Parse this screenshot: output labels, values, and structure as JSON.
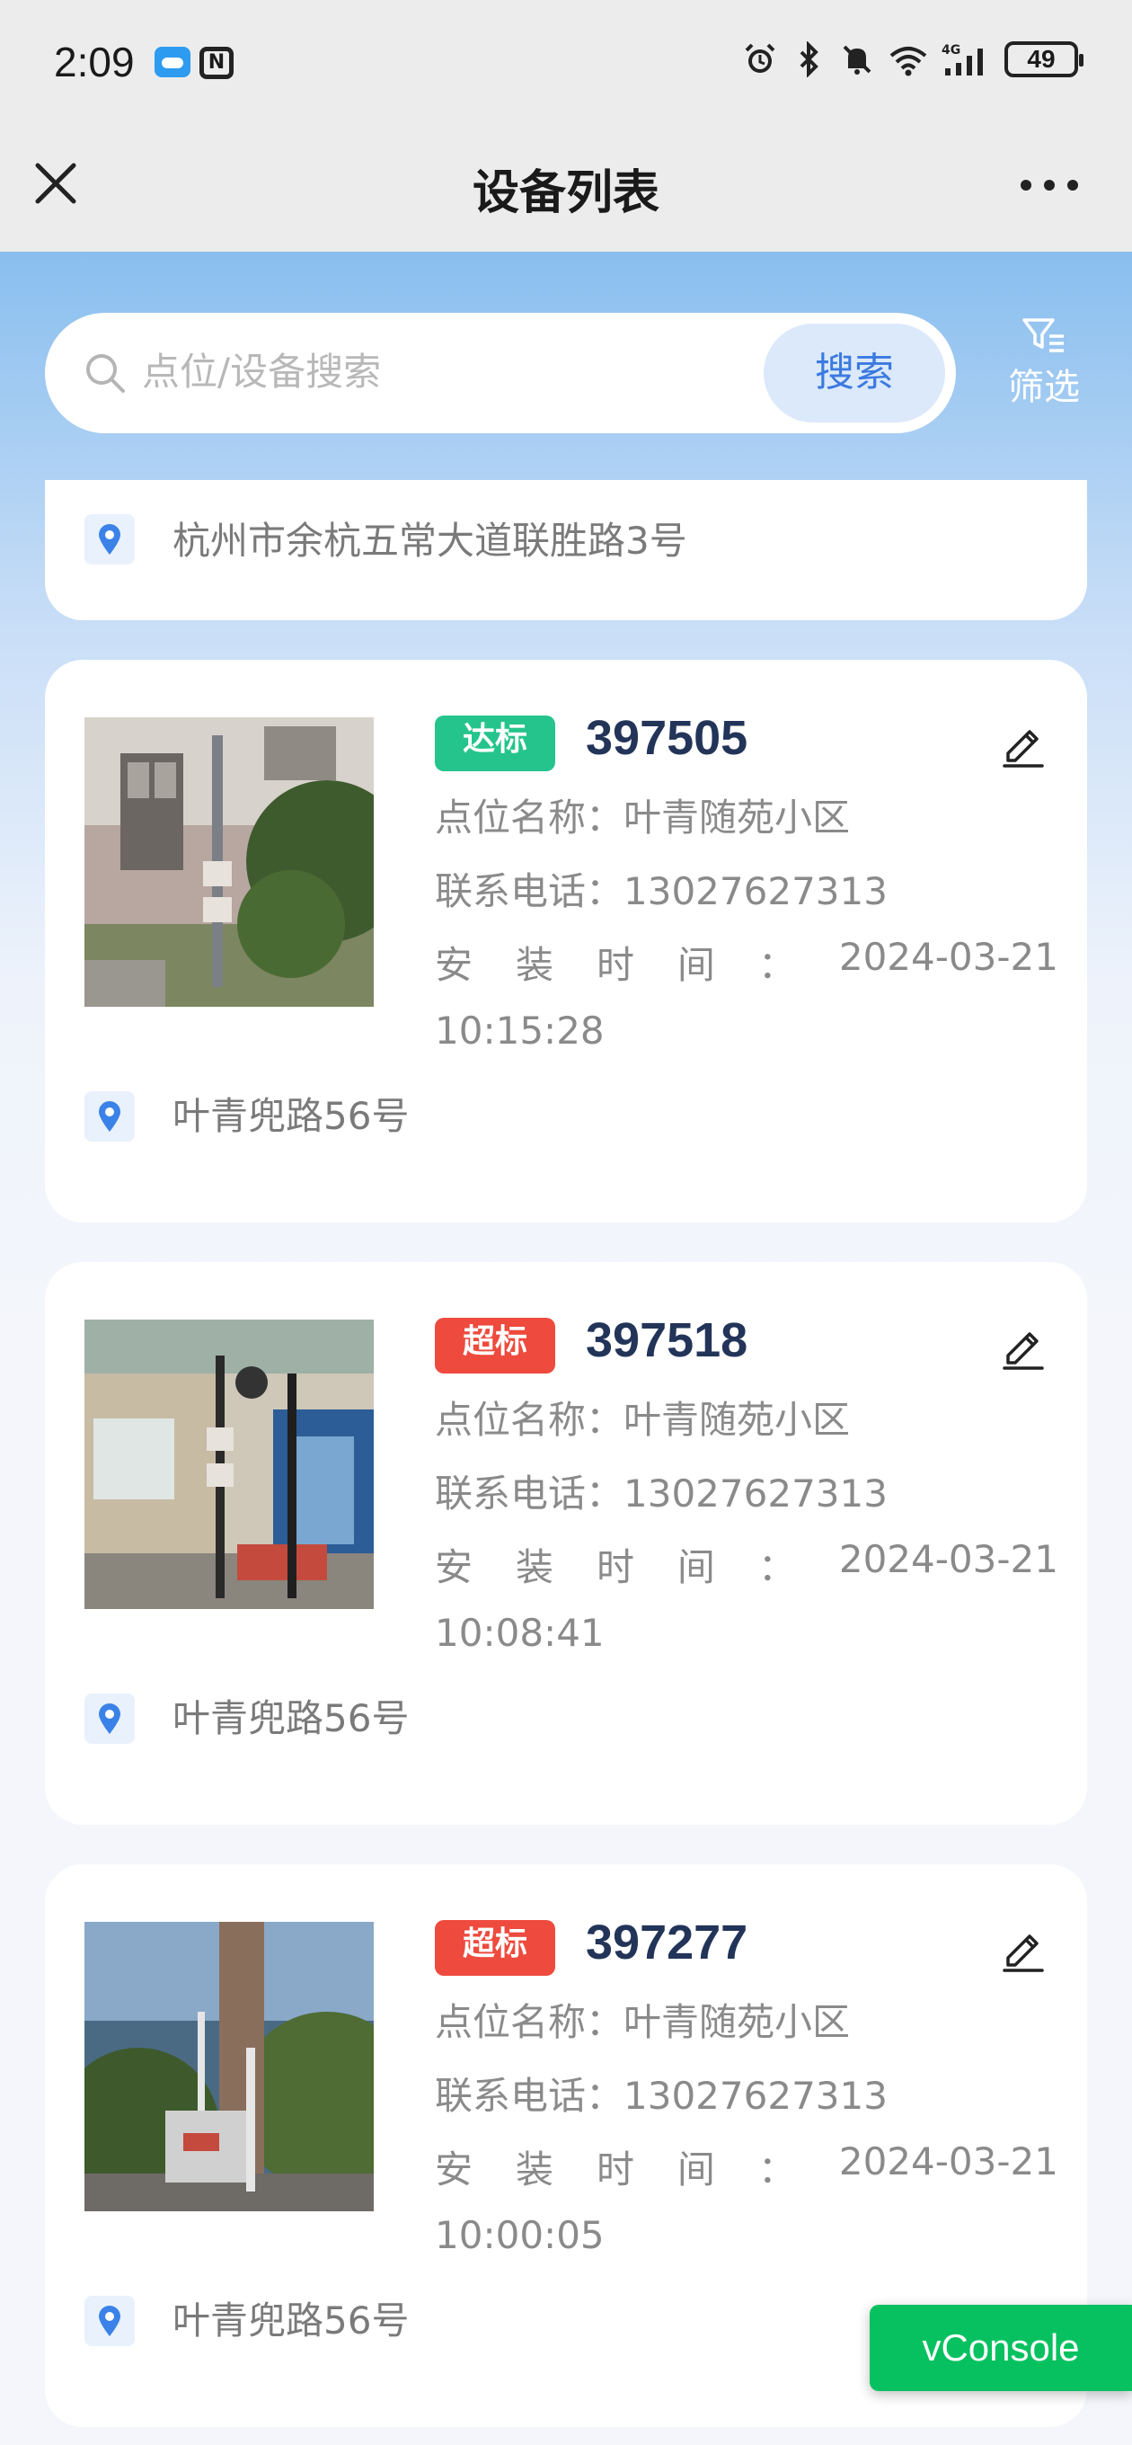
{
  "status_bar": {
    "time": "2:09",
    "nfc_label": "N",
    "battery": "49"
  },
  "header": {
    "title": "设备列表"
  },
  "search": {
    "placeholder": "点位/设备搜索",
    "button_label": "搜索",
    "filter_label": "筛选"
  },
  "partial_card": {
    "address": "杭州市余杭五常大道联胜路3号"
  },
  "labels": {
    "site_name": "点位名称：",
    "phone": "联系电话：",
    "install_chars": [
      "安",
      "装",
      "时",
      "间",
      "：",
      "2024-03-21"
    ]
  },
  "devices": [
    {
      "status": "达标",
      "status_type": "ok",
      "status_color": "#25c48c",
      "id": "397505",
      "site_name": "叶青随苑小区",
      "phone": "13027627313",
      "install_time": "10:15:28",
      "address": "叶青兜路56号"
    },
    {
      "status": "超标",
      "status_type": "bad",
      "status_color": "#ee4a3e",
      "id": "397518",
      "site_name": "叶青随苑小区",
      "phone": "13027627313",
      "install_time": "10:08:41",
      "address": "叶青兜路56号"
    },
    {
      "status": "超标",
      "status_type": "bad",
      "status_color": "#ee4a3e",
      "id": "397277",
      "site_name": "叶青随苑小区",
      "phone": "13027627313",
      "install_time": "10:00:05",
      "address": "叶青兜路56号"
    }
  ],
  "vconsole": {
    "label": "vConsole"
  },
  "colors": {
    "accent": "#3b7ae0",
    "header_gradient_top": "#5ba2e4",
    "vconsole": "#07c160"
  }
}
